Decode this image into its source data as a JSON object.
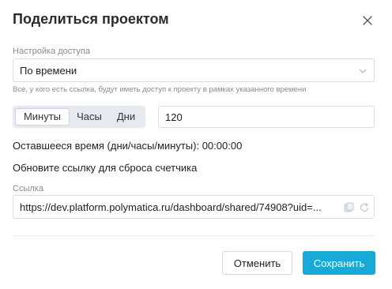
{
  "dialog": {
    "title": "Поделиться проектом"
  },
  "access": {
    "label": "Настройка доступа",
    "selected": "По времени",
    "hint": "Все, у кого есть ссылка, будут иметь доступ к проекту в рамках указанного времени"
  },
  "units": {
    "options": [
      "Минуты",
      "Часы",
      "Дни"
    ],
    "active_index": 0
  },
  "duration": {
    "value": "120"
  },
  "remaining_text": "Оставшееся время (дни/часы/минуты): 00:00:00",
  "refresh_text": "Обновите ссылку для сброса счетчика",
  "link": {
    "label": "Ссылка",
    "url": "https://dev.platform.polymatica.ru/dashboard/shared/74908?uid=..."
  },
  "buttons": {
    "cancel": "Отменить",
    "save": "Сохранить"
  },
  "colors": {
    "accent": "#18a9d9",
    "segment_bg": "#e6e9f0",
    "border": "#dcdcdc",
    "muted_text": "#8a8a8a"
  },
  "icons": {
    "close": "close-icon",
    "dropdown": "chevron-down-icon",
    "copy": "copy-icon",
    "refresh": "refresh-icon"
  }
}
